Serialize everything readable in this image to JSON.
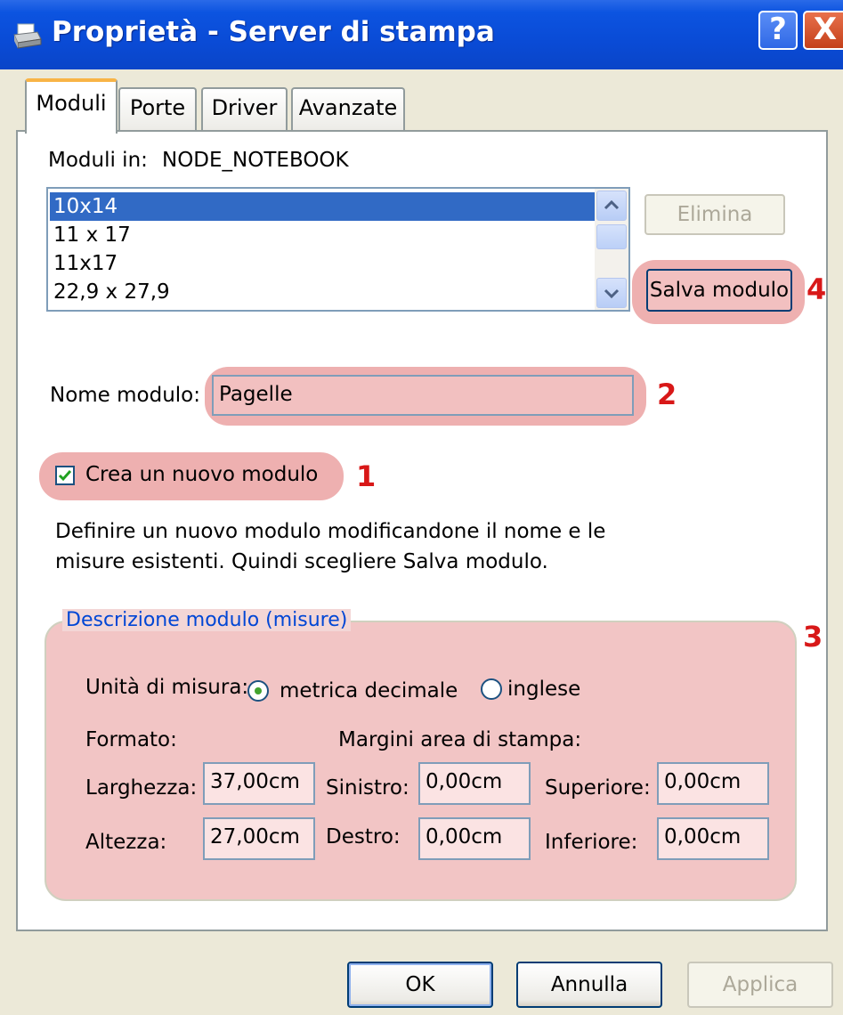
{
  "window": {
    "title": "Proprietà - Server di stampa",
    "help_glyph": "?",
    "close_glyph": "X"
  },
  "tabs": [
    {
      "label": "Moduli",
      "active": true
    },
    {
      "label": "Porte",
      "active": false
    },
    {
      "label": "Driver",
      "active": false
    },
    {
      "label": "Avanzate",
      "active": false
    }
  ],
  "forms": {
    "label": "Moduli in:",
    "server": "NODE_NOTEBOOK",
    "list": [
      "10x14",
      "11 x 17",
      "11x17",
      "22,9 x 27,9"
    ],
    "selected_index": 0,
    "delete_label": "Elimina",
    "save_label": "Salva modulo",
    "name_label": "Nome modulo:",
    "name_value": "Pagelle",
    "create_new_label": "Crea un nuovo modulo",
    "create_new_checked": true,
    "help_text_line1": "Definire un nuovo modulo modificandone il nome e le",
    "help_text_line2": "misure esistenti. Quindi scegliere Salva modulo."
  },
  "description": {
    "legend": "Descrizione modulo (misure)",
    "units_label": "Unità di misura:",
    "unit_metric": "metrica decimale",
    "unit_english": "inglese",
    "unit_selected": "metric",
    "format_label": "Formato:",
    "margins_label": "Margini area di stampa:",
    "width_label": "Larghezza:",
    "width_value": "37,00cm",
    "height_label": "Altezza:",
    "height_value": "27,00cm",
    "left_label": "Sinistro:",
    "left_value": "0,00cm",
    "right_label": "Destro:",
    "right_value": "0,00cm",
    "top_label": "Superiore:",
    "top_value": "0,00cm",
    "bottom_label": "Inferiore:",
    "bottom_value": "0,00cm"
  },
  "annotations": {
    "step1": "1",
    "step2": "2",
    "step3": "3",
    "step4": "4"
  },
  "footer": {
    "ok_label": "OK",
    "cancel_label": "Annulla",
    "apply_label": "Applica"
  },
  "colors": {
    "titlebar": "#0a4bd6",
    "selection": "#316ac5",
    "highlight": "#e89696",
    "annotation": "#d81818",
    "legend": "#0046d5"
  }
}
